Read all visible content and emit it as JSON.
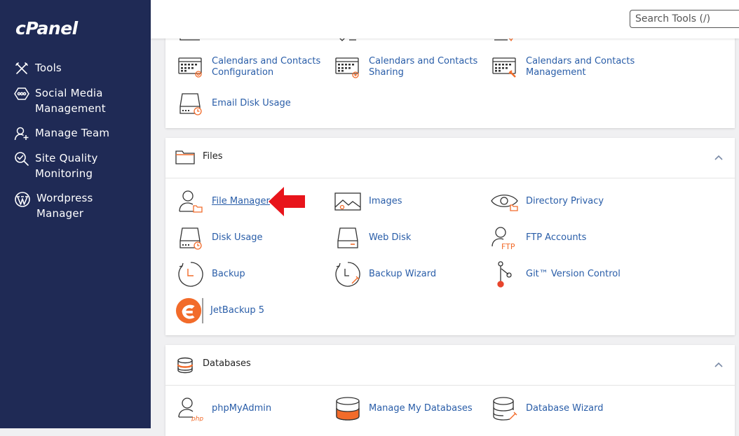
{
  "brand": {
    "logo_text": "cPanel"
  },
  "sidebar": {
    "items": [
      {
        "label": "Tools",
        "icon": "tools-icon"
      },
      {
        "label": "Social Media\nManagement",
        "icon": "social-media-icon"
      },
      {
        "label": "Manage Team",
        "icon": "manage-team-icon"
      },
      {
        "label": "Site Quality\nMonitoring",
        "icon": "site-quality-icon"
      },
      {
        "label": "Wordpress\nManager",
        "icon": "wordpress-icon"
      }
    ]
  },
  "search": {
    "placeholder": "Search Tools (/)"
  },
  "email_section": {
    "items": [
      {
        "label": "Calendars and Contacts\nConfiguration",
        "icon": "calendar-config-icon"
      },
      {
        "label": "Calendars and Contacts\nSharing",
        "icon": "calendar-sharing-icon"
      },
      {
        "label": "Calendars and Contacts\nManagement",
        "icon": "calendar-management-icon"
      },
      {
        "label": "Email Disk Usage",
        "icon": "email-disk-usage-icon"
      }
    ]
  },
  "files_section": {
    "title": "Files",
    "items": [
      {
        "label": "File Manager",
        "icon": "file-manager-icon"
      },
      {
        "label": "Images",
        "icon": "images-icon"
      },
      {
        "label": "Directory Privacy",
        "icon": "directory-privacy-icon"
      },
      {
        "label": "Disk Usage",
        "icon": "disk-usage-icon"
      },
      {
        "label": "Web Disk",
        "icon": "web-disk-icon"
      },
      {
        "label": "FTP Accounts",
        "icon": "ftp-accounts-icon"
      },
      {
        "label": "Backup",
        "icon": "backup-icon"
      },
      {
        "label": "Backup Wizard",
        "icon": "backup-wizard-icon"
      },
      {
        "label": "Git™ Version Control",
        "icon": "git-icon"
      },
      {
        "label": "JetBackup 5",
        "icon": "jetbackup-icon"
      }
    ]
  },
  "databases_section": {
    "title": "Databases",
    "items": [
      {
        "label": "phpMyAdmin",
        "icon": "phpmyadmin-icon",
        "icon_badge": "php"
      },
      {
        "label": "Manage My Databases",
        "icon": "manage-databases-icon"
      },
      {
        "label": "Database Wizard",
        "icon": "database-wizard-icon"
      }
    ]
  },
  "icon_badges": {
    "ftp": "FTP"
  },
  "colors": {
    "sidebar_bg": "#1f2a55",
    "link": "#295da8",
    "accent_orange": "#f26b2a",
    "arrow_red": "#e8141b"
  }
}
